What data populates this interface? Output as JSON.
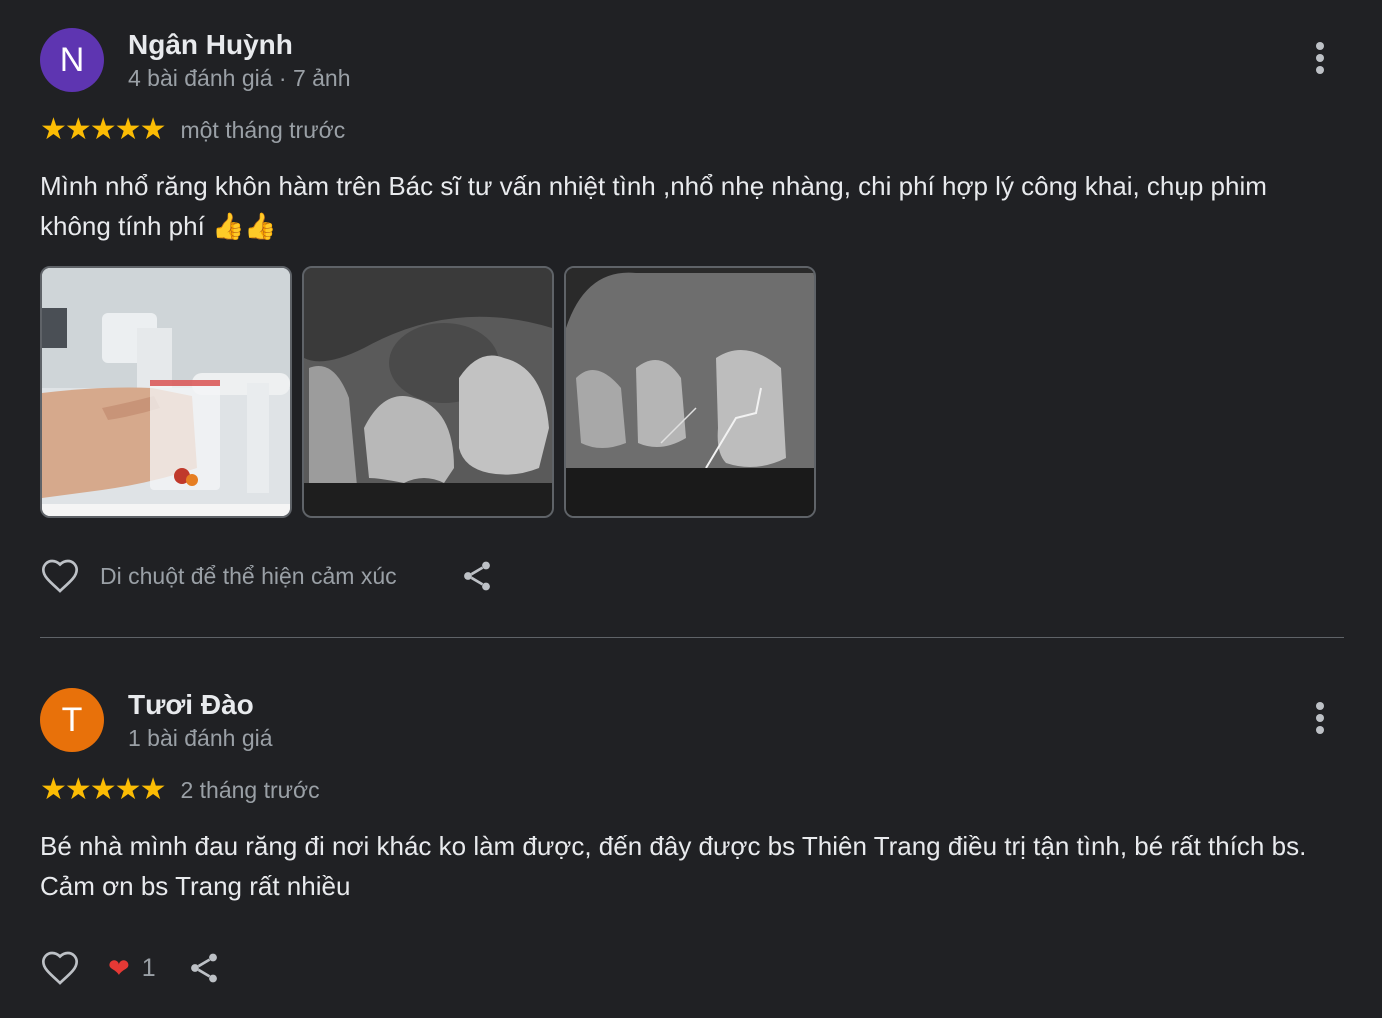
{
  "reviews": [
    {
      "avatar_letter": "N",
      "avatar_color": "#5e35b1",
      "author": "Ngân Huỳnh",
      "meta": "4 bài đánh giá · 7 ảnh",
      "stars": "★★★★★",
      "date": "một tháng trước",
      "text": "Mình nhổ răng khôn hàm trên Bác sĩ tư vấn nhiệt tình ,nhổ nhẹ nhàng, chi phí hợp lý công khai, chụp phim không tính phí 👍👍",
      "reaction_prompt": "Di chuột để thể hiện cảm xúc"
    },
    {
      "avatar_letter": "T",
      "avatar_color": "#e8710a",
      "author": "Tươi Đào",
      "meta": "1 bài đánh giá",
      "stars": "★★★★★",
      "date": "2 tháng trước",
      "text": "Bé nhà mình đau răng đi nơi khác ko làm được, đến đây được bs Thiên Trang điều trị tận tình, bé rất thích bs. Cảm ơn bs Trang rất nhiều",
      "reaction_emoji": "❤",
      "reaction_count": "1"
    }
  ],
  "colors": {
    "background": "#202124",
    "star": "#fbbc04",
    "muted_text": "#9aa0a6",
    "primary_text": "#e8eaed"
  }
}
